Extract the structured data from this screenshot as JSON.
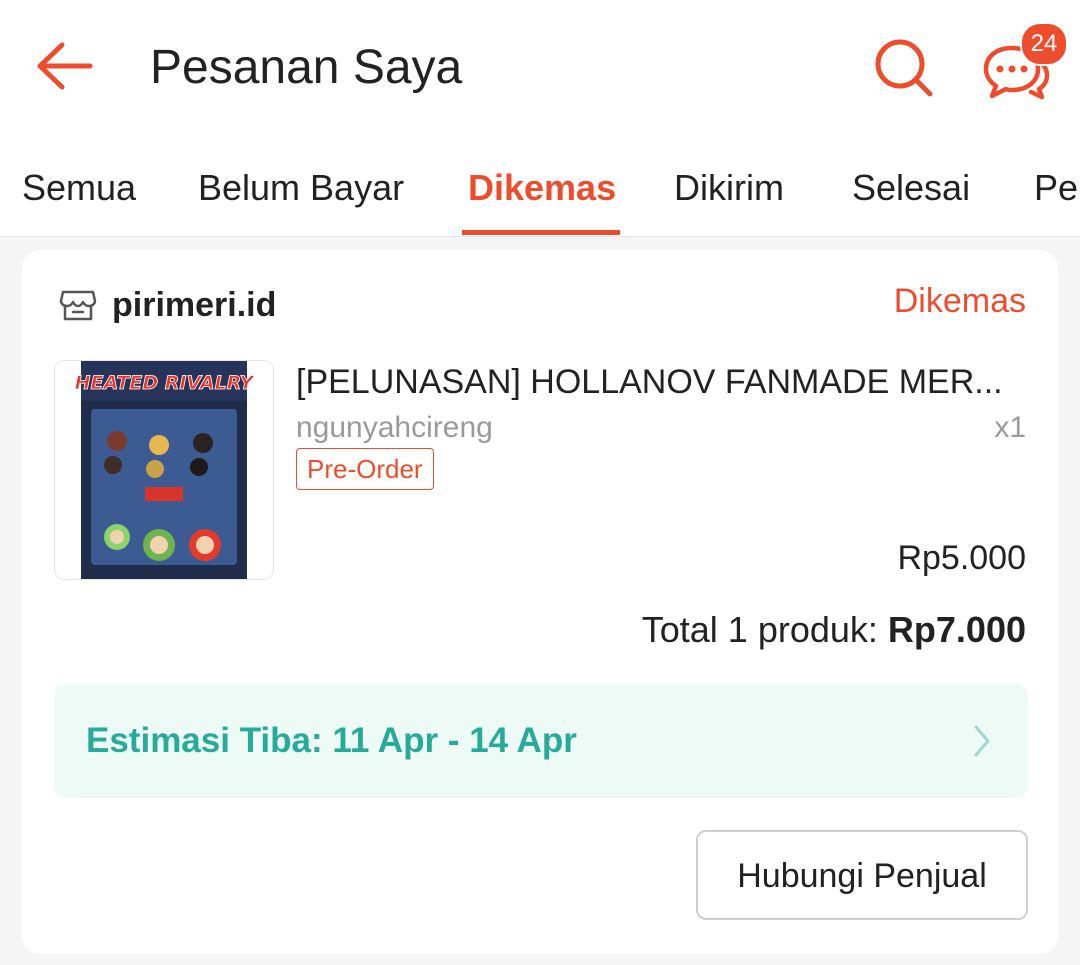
{
  "header": {
    "title": "Pesanan Saya",
    "chat_badge_count": "24",
    "icons": {
      "back": "back-arrow-icon",
      "search": "search-icon",
      "chat": "chat-icon"
    }
  },
  "tabs": [
    {
      "label": "Semua",
      "active": false
    },
    {
      "label": "Belum Bayar",
      "active": false
    },
    {
      "label": "Dikemas",
      "active": true
    },
    {
      "label": "Dikirim",
      "active": false
    },
    {
      "label": "Selesai",
      "active": false
    },
    {
      "label": "Pe",
      "active": false
    }
  ],
  "order": {
    "shop_name": "pirimeri.id",
    "status": "Dikemas",
    "product": {
      "name": "[PELUNASAN] HOLLANOV FANMADE MER...",
      "variation": "ngunyahcireng",
      "quantity": "x1",
      "badge": "Pre-Order",
      "price": "Rp5.000",
      "thumbnail_text": "HEATED RIVALRY"
    },
    "total_label": "Total 1 produk: ",
    "total_amount": "Rp7.000",
    "estimate": "Estimasi Tiba: 11 Apr - 14 Apr",
    "contact_button": "Hubungi Penjual"
  },
  "colors": {
    "brand": "#ee4d2d",
    "estimate_text": "#26aa99",
    "estimate_bg": "#eefaf6"
  }
}
